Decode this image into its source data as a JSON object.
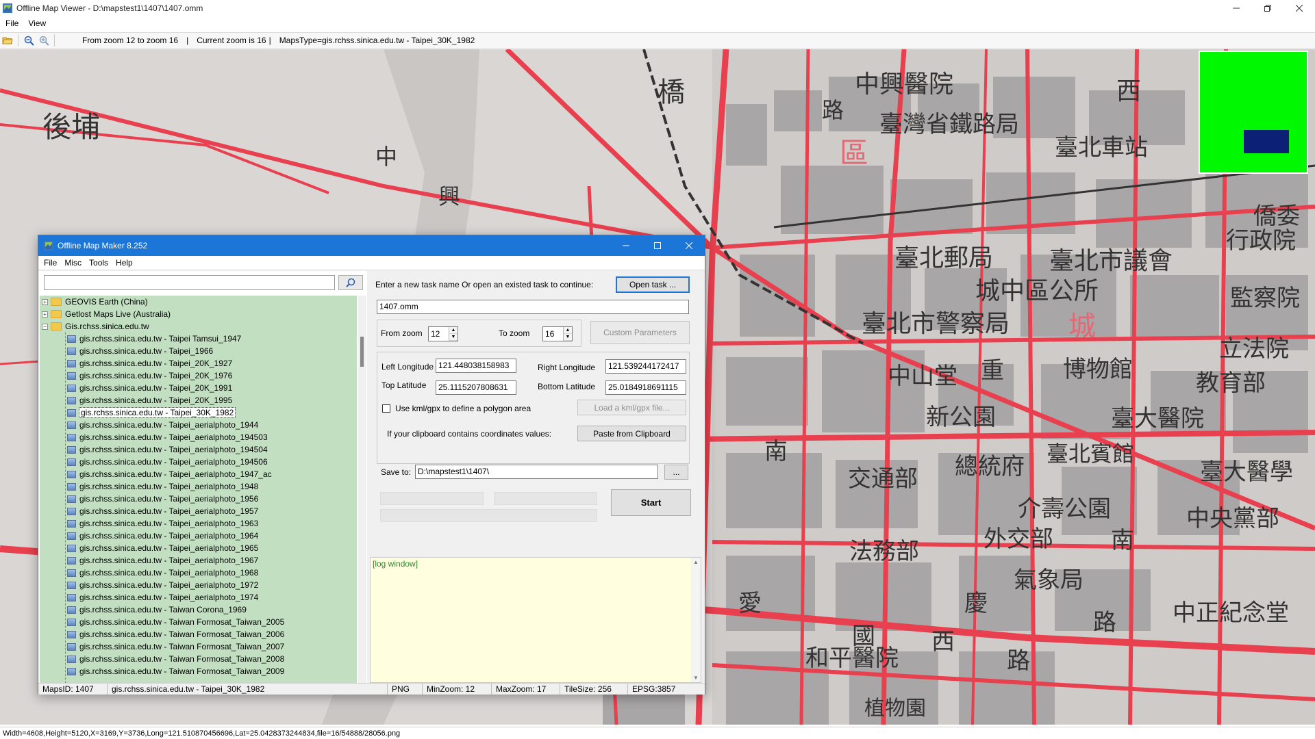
{
  "window": {
    "title": "Offline Map Viewer - D:\\mapstest1\\1407\\1407.omm",
    "menu": [
      "File",
      "View"
    ]
  },
  "toolbar": {
    "zoom_range": "From zoom 12 to zoom 16",
    "sep1": "|",
    "current_zoom": "Current zoom is 16",
    "sep2": "|",
    "maps_type": "MapsType=gis.rchss.sinica.edu.tw - Taipei_30K_1982"
  },
  "map": {
    "labels": [
      "後埔",
      "中興醫院",
      "臺灣省鐵路局",
      "臺北車站",
      "區",
      "西",
      "橋",
      "路",
      "中",
      "興",
      "臺北郵局",
      "臺北市議會",
      "城中區公所",
      "臺北市警察局",
      "城",
      "中山堂",
      "博物館",
      "新公園",
      "臺大醫院",
      "總統府",
      "臺北賓館",
      "交通部",
      "介壽公園",
      "外交部",
      "法務部",
      "氣象局",
      "中央黨部",
      "中正紀念堂",
      "和平醫院",
      "植物園",
      "行政院",
      "監察院",
      "立法院",
      "教育部",
      "臺大醫學",
      "僑委",
      "愛",
      "國",
      "西",
      "路",
      "南",
      "重",
      "慶",
      "南",
      "路"
    ],
    "minimap": {
      "background": "#00f800",
      "viewport_color": "#0c2176"
    },
    "colors": {
      "road": "#e8404f",
      "block": "#a8a6a6",
      "paper": "#d9d6d4"
    }
  },
  "statusbar": {
    "text": "Width=4608,Height=5120,X=3169,Y=3736,Long=121.510870456696,Lat=25.0428373244834,file=16/54888/28056.png"
  },
  "dialog": {
    "title": "Offline Map Maker 8.252",
    "menu": [
      "File",
      "Misc",
      "Tools",
      "Help"
    ],
    "search": {
      "value": "",
      "placeholder": ""
    },
    "tree": {
      "groups": [
        {
          "label": "GEOVIS Earth (China)",
          "expanded": false
        },
        {
          "label": "Getlost Maps Live (Australia)",
          "expanded": false
        },
        {
          "label": "Gis.rchss.sinica.edu.tw",
          "expanded": true
        }
      ],
      "children": [
        "gis.rchss.sinica.edu.tw - Taipei Tamsui_1947",
        "gis.rchss.sinica.edu.tw - Taipei_1966",
        "gis.rchss.sinica.edu.tw - Taipei_20K_1927",
        "gis.rchss.sinica.edu.tw - Taipei_20K_1976",
        "gis.rchss.sinica.edu.tw - Taipei_20K_1991",
        "gis.rchss.sinica.edu.tw - Taipei_20K_1995",
        "gis.rchss.sinica.edu.tw - Taipei_30K_1982",
        "gis.rchss.sinica.edu.tw - Taipei_aerialphoto_1944",
        "gis.rchss.sinica.edu.tw - Taipei_aerialphoto_194503",
        "gis.rchss.sinica.edu.tw - Taipei_aerialphoto_194504",
        "gis.rchss.sinica.edu.tw - Taipei_aerialphoto_194506",
        "gis.rchss.sinica.edu.tw - Taipei_aerialphoto_1947_ac",
        "gis.rchss.sinica.edu.tw - Taipei_aerialphoto_1948",
        "gis.rchss.sinica.edu.tw - Taipei_aerialphoto_1956",
        "gis.rchss.sinica.edu.tw - Taipei_aerialphoto_1957",
        "gis.rchss.sinica.edu.tw - Taipei_aerialphoto_1963",
        "gis.rchss.sinica.edu.tw - Taipei_aerialphoto_1964",
        "gis.rchss.sinica.edu.tw - Taipei_aerialphoto_1965",
        "gis.rchss.sinica.edu.tw - Taipei_aerialphoto_1967",
        "gis.rchss.sinica.edu.tw - Taipei_aerialphoto_1968",
        "gis.rchss.sinica.edu.tw - Taipei_aerialphoto_1972",
        "gis.rchss.sinica.edu.tw - Taipei_aerialphoto_1974",
        "gis.rchss.sinica.edu.tw - Taiwan Corona_1969",
        "gis.rchss.sinica.edu.tw - Taiwan Formosat_Taiwan_2005",
        "gis.rchss.sinica.edu.tw - Taiwan Formosat_Taiwan_2006",
        "gis.rchss.sinica.edu.tw - Taiwan Formosat_Taiwan_2007",
        "gis.rchss.sinica.edu.tw - Taiwan Formosat_Taiwan_2008",
        "gis.rchss.sinica.edu.tw - Taiwan Formosat_Taiwan_2009"
      ],
      "selected_index": 6
    },
    "task": {
      "prompt": "Enter a new task name Or open an existed task to continue:",
      "open_button": "Open task ...",
      "task_name": "1407.omm"
    },
    "zoom": {
      "from_label": "From zoom",
      "from_value": "12",
      "to_label": "To zoom",
      "to_value": "16",
      "custom_button": "Custom Parameters"
    },
    "bounds": {
      "left_lon_label": "Left Longitude",
      "left_lon": "121.448038158983",
      "right_lon_label": "Right Longitude",
      "right_lon": "121.539244172417",
      "top_lat_label": "Top Latitude",
      "top_lat": "25.1115207808631",
      "bottom_lat_label": "Bottom Latitude",
      "bottom_lat": "25.0184918691115",
      "kml_label": "Use kml/gpx to define a polygon area",
      "kml_checked": false,
      "load_kml_button": "Load a kml/gpx file...",
      "clipboard_label": "If your clipboard contains coordinates values:",
      "paste_button": "Paste from Clipboard"
    },
    "save": {
      "label": "Save to:",
      "path": "D:\\mapstest1\\1407\\",
      "browse_button": "...",
      "start_button": "Start"
    },
    "progress": {
      "bar1": 0,
      "bar2": 0,
      "bar3": 0
    },
    "log": {
      "text": "[log window]"
    },
    "status": {
      "maps_id": "MapsID: 1407",
      "maps_name": "gis.rchss.sinica.edu.tw - Taipei_30K_1982",
      "format": "PNG",
      "min_zoom": "MinZoom: 12",
      "max_zoom": "MaxZoom: 17",
      "tile_size": "TileSize: 256",
      "epsg": "EPSG:3857"
    }
  }
}
